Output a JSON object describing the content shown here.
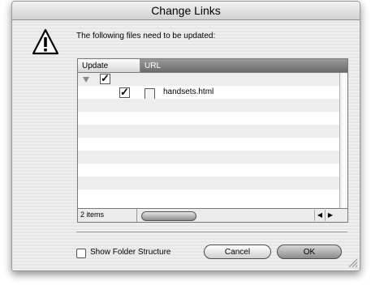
{
  "dialog": {
    "title": "Change Links",
    "message": "The following files need to be updated:",
    "icon": "warning-icon"
  },
  "table": {
    "headers": {
      "update": "Update",
      "url": "URL"
    },
    "rows": [
      {
        "type": "folder",
        "checked": true,
        "label": ""
      },
      {
        "type": "file",
        "checked": true,
        "label": "handsets.html",
        "icon": "html-file-icon"
      }
    ],
    "status": "2 items"
  },
  "options": {
    "show_folder_structure_label": "Show Folder Structure",
    "show_folder_structure_checked": false
  },
  "buttons": {
    "cancel": "Cancel",
    "ok": "OK"
  }
}
